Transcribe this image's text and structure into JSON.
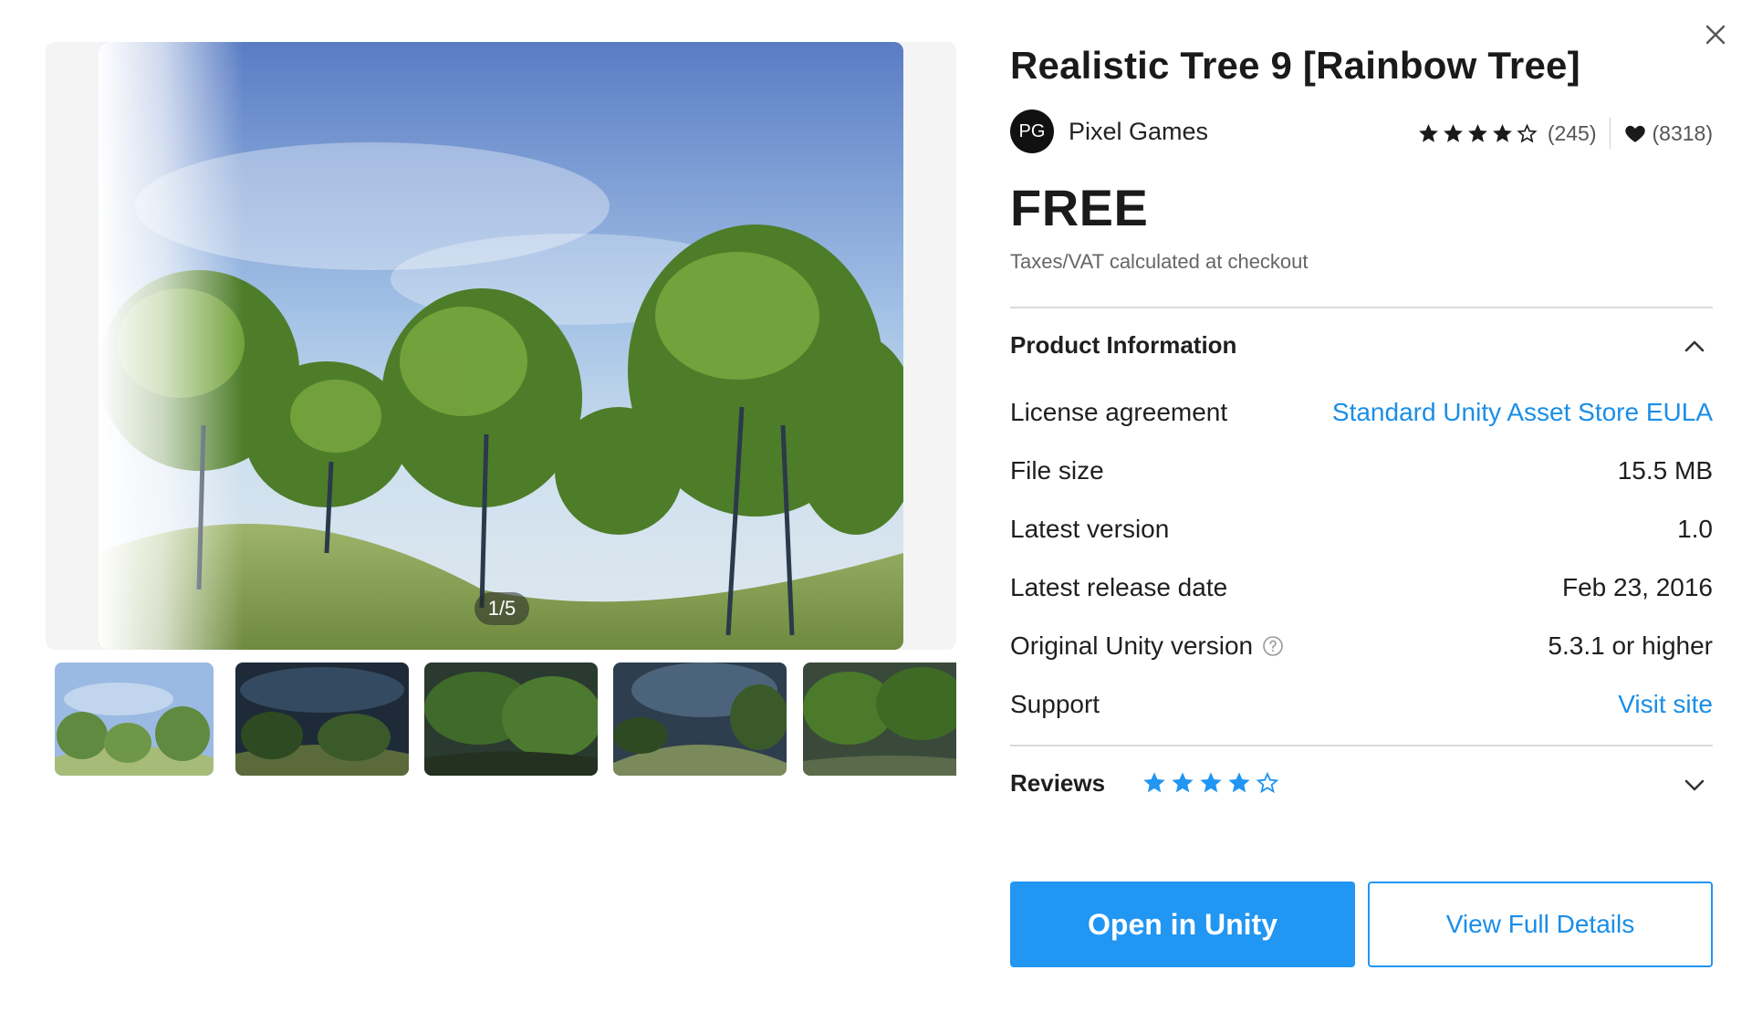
{
  "product": {
    "title": "Realistic Tree 9 [Rainbow Tree]",
    "publisher": "Pixel Games",
    "publisher_initials": "PG",
    "rating_stars": 4,
    "rating_count": "(245)",
    "favorites_count": "(8318)",
    "price": "FREE",
    "taxes_note": "Taxes/VAT calculated at checkout"
  },
  "gallery": {
    "counter": "1/5",
    "thumbnail_count": 5
  },
  "product_info": {
    "title": "Product Information",
    "rows": [
      {
        "label": "License agreement",
        "value": "Standard Unity Asset Store EULA"
      },
      {
        "label": "File size",
        "value": "15.5 MB"
      },
      {
        "label": "Latest version",
        "value": "1.0"
      },
      {
        "label": "Latest release date",
        "value": "Feb 23, 2016"
      },
      {
        "label": "Original Unity version",
        "value": "5.3.1 or higher"
      },
      {
        "label": "Support",
        "value": "Visit site"
      }
    ]
  },
  "reviews": {
    "title": "Reviews",
    "stars": 4
  },
  "actions": {
    "primary": "Open in Unity",
    "secondary": "View Full Details"
  },
  "colors": {
    "accent": "#2196f3",
    "link": "#1a8ee8",
    "text": "#1f1f1f",
    "muted": "#666666"
  },
  "icons": [
    "close-icon",
    "star-icon",
    "heart-icon",
    "chevron-up-icon",
    "chevron-down-icon",
    "help-icon"
  ]
}
